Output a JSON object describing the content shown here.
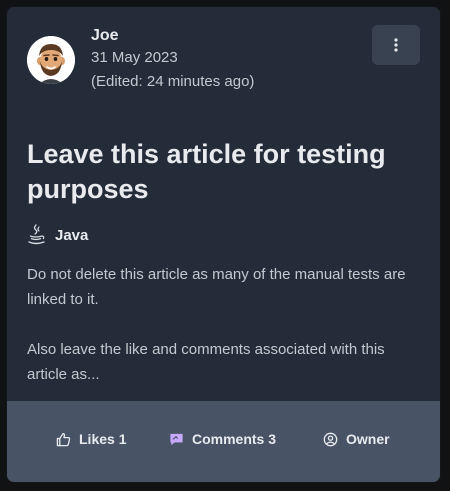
{
  "post": {
    "author": "Joe",
    "date": "31 May 2023",
    "edited": "(Edited: 24 minutes ago)",
    "title": "Leave this article for testing purposes",
    "language": "Java",
    "body": [
      "Do not delete this article as many of the manual tests are linked to it.",
      "Also leave the like and comments associated with this article as..."
    ]
  },
  "actions": {
    "likes": "Likes 1",
    "comments": "Comments 3",
    "owner": "Owner"
  },
  "icons": {
    "menu": "more-vertical-icon",
    "language": "java-coffee-icon",
    "likes": "thumbs-up-icon",
    "comments": "comment-icon",
    "owner": "user-circle-icon"
  },
  "colors": {
    "card_bg": "#232c38",
    "footer_bg": "#485466",
    "comment_icon": "#c7a8ff"
  }
}
